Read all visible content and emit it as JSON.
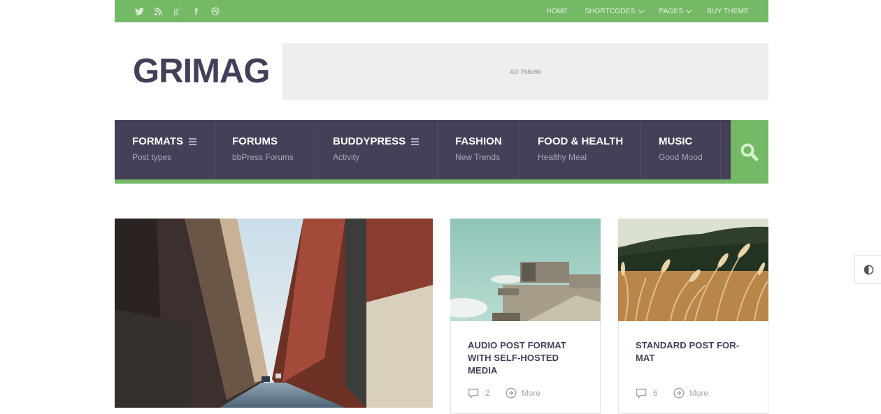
{
  "topbar": {
    "social_icons": [
      "twitter-icon",
      "rss-icon",
      "google-plus-icon",
      "facebook-icon",
      "dribbble-icon"
    ],
    "nav": [
      {
        "label": "HOME",
        "dropdown": false
      },
      {
        "label": "SHORTCODES",
        "dropdown": true
      },
      {
        "label": "PAGES",
        "dropdown": true
      },
      {
        "label": "BUY THEME",
        "dropdown": false
      }
    ]
  },
  "header": {
    "logo": "GRIMAG",
    "ad_label": "AD 768x90"
  },
  "mainnav": {
    "items": [
      {
        "title": "FORMATS",
        "subtitle": "Post types",
        "menu_icon": true
      },
      {
        "title": "FORUMS",
        "subtitle": "bbPress Forums",
        "menu_icon": false
      },
      {
        "title": "BUDDYPRESS",
        "subtitle": "Activity",
        "menu_icon": true
      },
      {
        "title": "FASHION",
        "subtitle": "New Trends",
        "menu_icon": false
      },
      {
        "title": "FOOD & HEALTH",
        "subtitle": "Healthy Meal",
        "menu_icon": false
      },
      {
        "title": "MUSIC",
        "subtitle": "Good Mood",
        "menu_icon": false
      }
    ],
    "search_icon": "search-icon"
  },
  "posts": {
    "featured": {
      "image": "city-street-photo"
    },
    "cards": [
      {
        "image": "concrete-bunker-photo",
        "title": "AUDIO POST FORMAT WITH SELF-HOSTED MEDIA",
        "comments": "2",
        "more_label": "More"
      },
      {
        "image": "wheat-field-photo",
        "title": "STANDARD POST FOR-MAT",
        "comments": "6",
        "more_label": "More"
      }
    ]
  },
  "widgets": {
    "contrast_icon": "contrast-icon"
  },
  "colors": {
    "green": "#74b966",
    "purple": "#463f58",
    "logo": "#453e59"
  }
}
